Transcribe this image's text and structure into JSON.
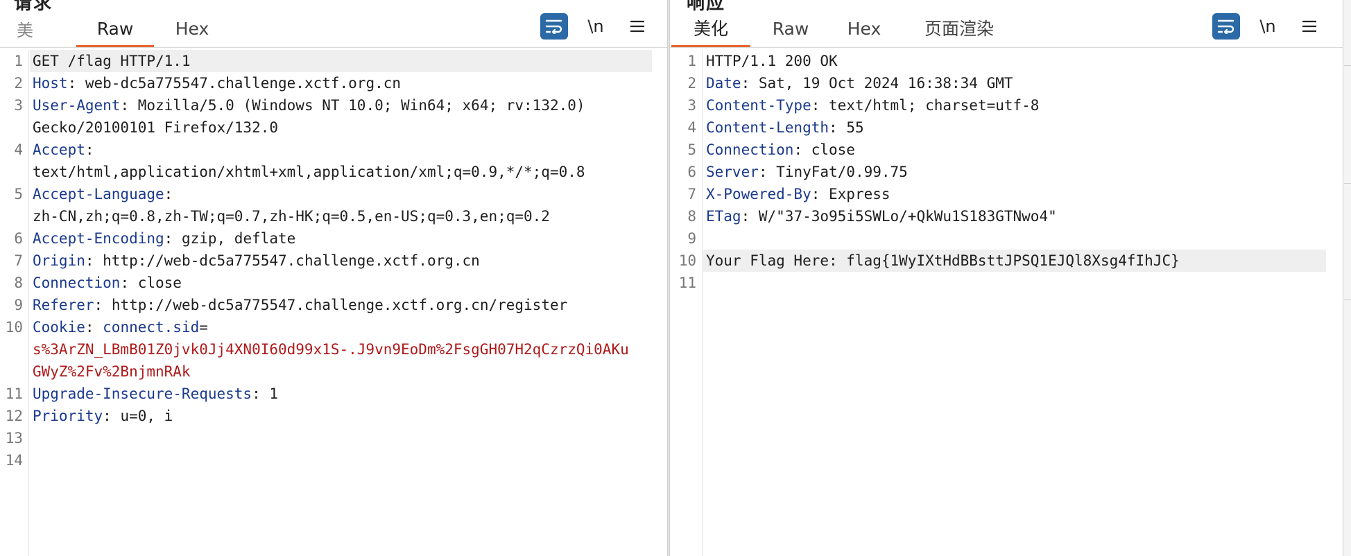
{
  "request": {
    "title": "请求",
    "tab_stub": "美",
    "tabs": [
      {
        "label": "Raw",
        "active": true
      },
      {
        "label": "Hex",
        "active": false
      }
    ],
    "toolbar": {
      "newline_label": "\\n"
    },
    "lines": [
      {
        "n": "1",
        "text": "GET /flag HTTP/1.1"
      },
      {
        "n": "2",
        "key": "Host",
        "sep": ": ",
        "value": "web-dc5a775547.challenge.xctf.org.cn"
      },
      {
        "n": "3",
        "key": "User-Agent",
        "sep": ": ",
        "value": "Mozilla/5.0 (Windows NT 10.0; Win64; x64; rv:132.0)"
      },
      {
        "n": "",
        "text": "Gecko/20100101 Firefox/132.0"
      },
      {
        "n": "4",
        "key": "Accept",
        "sep": ":"
      },
      {
        "n": "",
        "text": "text/html,application/xhtml+xml,application/xml;q=0.9,*/*;q=0.8"
      },
      {
        "n": "5",
        "key": "Accept-Language",
        "sep": ":"
      },
      {
        "n": "",
        "text": "zh-CN,zh;q=0.8,zh-TW;q=0.7,zh-HK;q=0.5,en-US;q=0.3,en;q=0.2"
      },
      {
        "n": "6",
        "key": "Accept-Encoding",
        "sep": ": ",
        "value": "gzip, deflate"
      },
      {
        "n": "7",
        "key": "Origin",
        "sep": ": ",
        "value": "http://web-dc5a775547.challenge.xctf.org.cn"
      },
      {
        "n": "8",
        "key": "Connection",
        "sep": ": ",
        "value": "close"
      },
      {
        "n": "9",
        "key": "Referer",
        "sep": ": ",
        "value": "http://web-dc5a775547.challenge.xctf.org.cn/register"
      },
      {
        "n": "10",
        "key": "Cookie",
        "sep": ": ",
        "cookie_name": "connect.sid",
        "cookie_eq": "="
      },
      {
        "n": "",
        "cookie_value": "s%3ArZN_LBmB01Z0jvk0Jj4XN0I60d99x1S-.J9vn9EoDm%2FsgGH07H2qCzrzQi0AKu"
      },
      {
        "n": "",
        "cookie_value": "GWyZ%2Fv%2BnjmnRAk"
      },
      {
        "n": "11",
        "key": "Upgrade-Insecure-Requests",
        "sep": ": ",
        "value": "1"
      },
      {
        "n": "12",
        "key": "Priority",
        "sep": ": ",
        "value": "u=0, i"
      },
      {
        "n": "13",
        "text": ""
      },
      {
        "n": "14",
        "text": ""
      }
    ]
  },
  "response": {
    "title": "响应",
    "tabs": [
      {
        "label": "美化",
        "active": true
      },
      {
        "label": "Raw",
        "active": false
      },
      {
        "label": "Hex",
        "active": false
      },
      {
        "label": "页面渲染",
        "active": false
      }
    ],
    "toolbar": {
      "newline_label": "\\n"
    },
    "lines": [
      {
        "n": "1",
        "text": "HTTP/1.1 200 OK"
      },
      {
        "n": "2",
        "key": "Date",
        "sep": ": ",
        "value": "Sat, 19 Oct 2024 16:38:34 GMT"
      },
      {
        "n": "3",
        "key": "Content-Type",
        "sep": ": ",
        "value": "text/html; charset=utf-8"
      },
      {
        "n": "4",
        "key": "Content-Length",
        "sep": ": ",
        "value": "55"
      },
      {
        "n": "5",
        "key": "Connection",
        "sep": ": ",
        "value": "close"
      },
      {
        "n": "6",
        "key": "Server",
        "sep": ": ",
        "value": "TinyFat/0.99.75"
      },
      {
        "n": "7",
        "key": "X-Powered-By",
        "sep": ": ",
        "value": "Express"
      },
      {
        "n": "8",
        "key": "ETag",
        "sep": ": ",
        "value": "W/\"37-3o95i5SWLo/+QkWu1S183GTNwo4\""
      },
      {
        "n": "9",
        "text": ""
      },
      {
        "n": "10",
        "text": "Your Flag Here: flag{1WyIXtHdBBsttJPSQ1EJQl8Xsg4fIhJC}"
      },
      {
        "n": "11",
        "text": ""
      }
    ]
  },
  "colors": {
    "header_key": "#1b3a8e",
    "cookie_value": "#b0191a",
    "active_tab_underline": "#e8652f",
    "wrap_button_bg": "#2b6aa6",
    "highlight_line_bg": "#efefef"
  },
  "icons": [
    "wrap-lines-icon",
    "menu-icon"
  ]
}
